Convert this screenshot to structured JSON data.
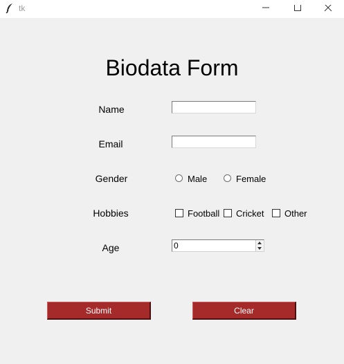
{
  "window": {
    "title": "tk",
    "icon": "feather-icon",
    "controls": [
      "minimize-icon",
      "maximize-icon",
      "close-icon"
    ]
  },
  "form": {
    "heading": "Biodata Form",
    "name": {
      "label": "Name",
      "value": ""
    },
    "email": {
      "label": "Email",
      "value": ""
    },
    "gender": {
      "label": "Gender",
      "options": [
        "Male",
        "Female"
      ],
      "selected": ""
    },
    "hobbies": {
      "label": "Hobbies",
      "options": [
        {
          "label": "Football",
          "checked": false
        },
        {
          "label": "Cricket",
          "checked": false
        },
        {
          "label": "Other",
          "checked": false
        }
      ]
    },
    "age": {
      "label": "Age",
      "value": "0"
    },
    "submit_label": "Submit",
    "clear_label": "Clear"
  },
  "colors": {
    "button_bg": "#a52a2a",
    "button_text": "#ffffff",
    "window_bg": "#f0f0f0"
  }
}
